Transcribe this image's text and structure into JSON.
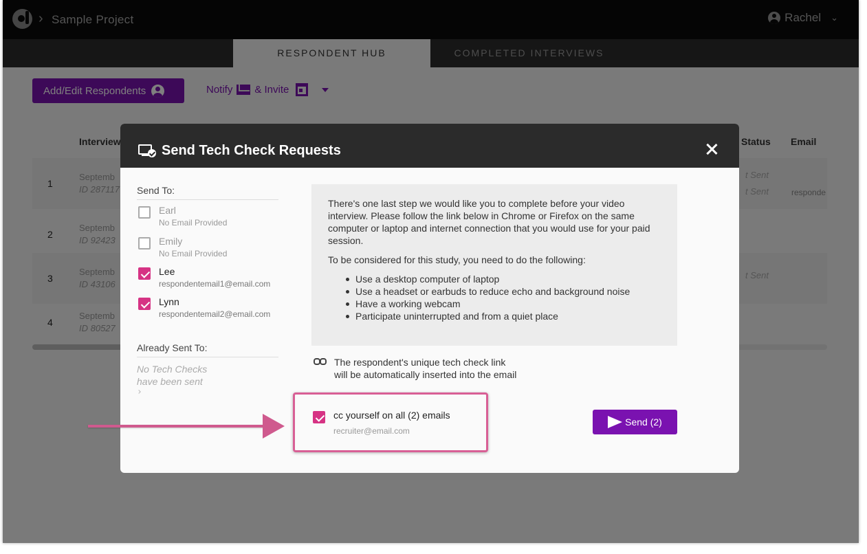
{
  "app": {
    "project_name": "Sample Project",
    "user_name": "Rachel"
  },
  "tabs": [
    {
      "label": "RESPONDENT HUB",
      "active": true
    },
    {
      "label": "COMPLETED INTERVIEWS",
      "active": false
    }
  ],
  "toolbar": {
    "add_edit_label": "Add/Edit Respondents",
    "notify_label": "Notify",
    "invite_label": "& Invite"
  },
  "table": {
    "headers": {
      "interview": "Interview",
      "status": "Status",
      "email": "Email"
    },
    "rows": [
      {
        "num": "1",
        "date": "Septemb",
        "id": "ID 287117"
      },
      {
        "num": "2",
        "date": "Septemb",
        "id": "ID 92423"
      },
      {
        "num": "3",
        "date": "Septemb",
        "id": "ID 43106"
      },
      {
        "num": "4",
        "date": "Septemb",
        "id": "ID 80527"
      }
    ],
    "status_fragments": [
      "t Sent",
      "t Sent",
      "t Sent"
    ],
    "email_fragment": "responde"
  },
  "modal": {
    "title": "Send Tech Check Requests",
    "send_to_label": "Send To:",
    "recipients": [
      {
        "name": "Earl",
        "sub": "No Email Provided",
        "checked": false
      },
      {
        "name": "Emily",
        "sub": "No Email Provided",
        "checked": false
      },
      {
        "name": "Lee",
        "sub": "respondentemail1@email.com",
        "checked": true
      },
      {
        "name": "Lynn",
        "sub": "respondentemail2@email.com",
        "checked": true
      }
    ],
    "already_sent_label": "Already Sent To:",
    "already_sent_empty": "No Tech Checks have been sent",
    "message": {
      "paragraph1": "There's one last step we would like you to complete before your video interview. Please follow the link below in Chrome or Firefox on the same computer or laptop and internet connection that you would use for your paid session.",
      "paragraph2": "To be considered for this study, you need to do the following:",
      "bullets": [
        "Use a desktop computer of laptop",
        "Use a headset or earbuds to reduce echo and background noise",
        "Have a working webcam",
        "Participate uninterrupted and from a quiet place"
      ]
    },
    "link_note_line1": "The respondent's unique tech check link",
    "link_note_line2": "will be automatically inserted into the email",
    "cc": {
      "label": "cc yourself on all (2) emails",
      "email": "recruiter@email.com",
      "checked": true
    },
    "send_label": "Send (2)"
  },
  "colors": {
    "brand_purple": "#7a12b0",
    "check_pink": "#d63384",
    "annotation_pink": "#cf5a8e"
  }
}
